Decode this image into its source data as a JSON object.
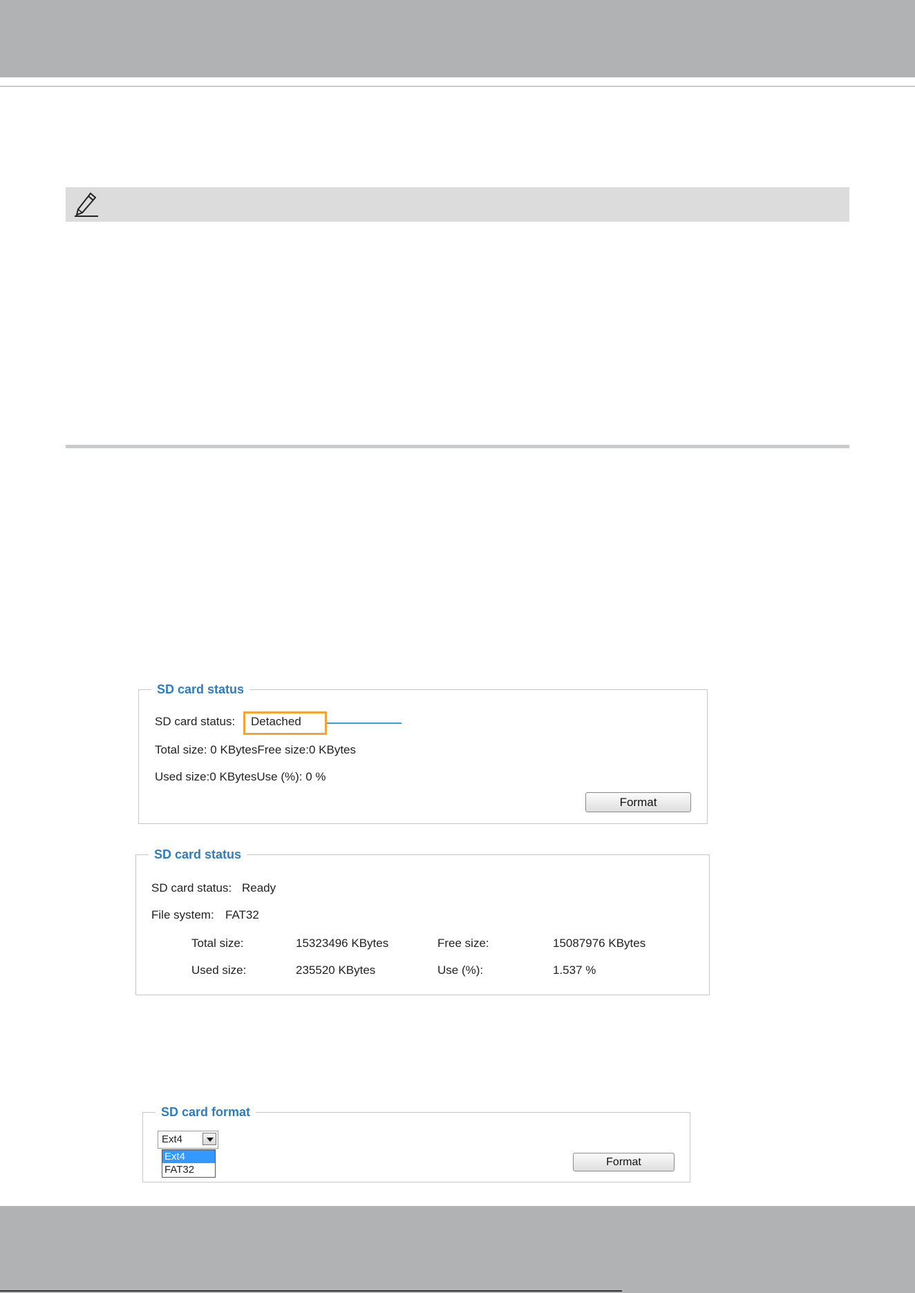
{
  "status_panel_detached": {
    "legend": "SD card status",
    "status_label": "SD card status:",
    "status_value": "Detached",
    "line1": "Total size: 0  KBytesFree size:0  KBytes",
    "line2": "Used size:0  KBytesUse (%):  0 %",
    "format_button": "Format"
  },
  "status_panel_ready": {
    "legend": "SD card status",
    "status_label": "SD card status:",
    "status_value": "Ready",
    "fs_label": "File system:",
    "fs_value": "FAT32",
    "total_label": "Total size:",
    "total_value": "15323496  KBytes",
    "free_label": "Free size:",
    "free_value": "15087976  KBytes",
    "used_label": "Used size:",
    "used_value": "235520  KBytes",
    "use_label": "Use (%):",
    "use_value": "1.537 %"
  },
  "format_panel": {
    "legend": "SD card format",
    "selected": "Ext4",
    "options": [
      "Ext4",
      "FAT32"
    ],
    "format_button": "Format"
  },
  "colors": {
    "legend": "#2b7fc1",
    "highlight_box": "#f2a533",
    "callout_line": "#3a9bd8"
  }
}
